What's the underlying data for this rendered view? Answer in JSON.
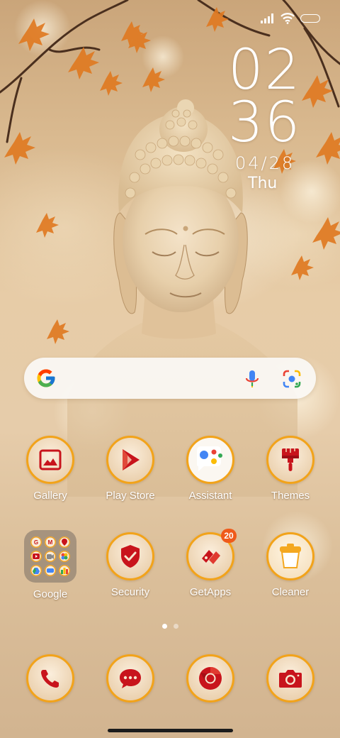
{
  "status_bar": {
    "icons": [
      "signal-icon",
      "wifi-icon",
      "battery-icon"
    ]
  },
  "clock": {
    "hour": "02",
    "minute": "36",
    "date": "04/28",
    "day": "Thu"
  },
  "search_bar": {
    "icons": [
      "google-logo-icon",
      "mic-icon",
      "lens-icon"
    ]
  },
  "apps": [
    {
      "label": "Gallery",
      "icon": "gallery-icon"
    },
    {
      "label": "Play Store",
      "icon": "play-store-icon"
    },
    {
      "label": "Assistant",
      "icon": "assistant-icon"
    },
    {
      "label": "Themes",
      "icon": "paintbrush-icon"
    },
    {
      "label": "Google",
      "icon": "folder-icon"
    },
    {
      "label": "Security",
      "icon": "shield-check-icon"
    },
    {
      "label": "GetApps",
      "icon": "getapps-icon",
      "badge": "20"
    },
    {
      "label": "Cleaner",
      "icon": "cleaner-bin-icon"
    }
  ],
  "folder_items": [
    "G",
    "M",
    "maps",
    "yt",
    "meet",
    "photos",
    "drive",
    "duo",
    "play"
  ],
  "page_indicator": {
    "pages": 2,
    "current": 1
  },
  "dock": [
    {
      "icon": "phone-icon"
    },
    {
      "icon": "messages-icon"
    },
    {
      "icon": "chrome-icon"
    },
    {
      "icon": "camera-icon"
    }
  ],
  "colors": {
    "icon_ring": "#f2a31a",
    "icon_red": "#c8141c",
    "badge": "#ef5a1b"
  }
}
